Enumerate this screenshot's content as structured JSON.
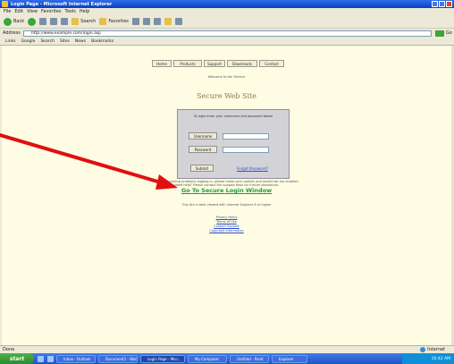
{
  "window": {
    "title": "Login Page - Microsoft Internet Explorer"
  },
  "menubar": [
    "File",
    "Edit",
    "View",
    "Favorites",
    "Tools",
    "Help"
  ],
  "toolbar": {
    "back_label": "Back",
    "search_label": "Search",
    "favorites_label": "Favorites"
  },
  "addressbar": {
    "label": "Address",
    "url": "http://www.example.com/login.asp",
    "go_label": "Go",
    "links_label": "Links"
  },
  "linksbar": [
    "Google",
    "Search",
    "Sites",
    "News",
    "Bookmarks"
  ],
  "page": {
    "nav": [
      "Home",
      "Products",
      "Support",
      "Downloads",
      "Contact"
    ],
    "welcome_line": "Welcome to the Service",
    "heading": "Secure Web Site",
    "login": {
      "prompt": "To login enter your username and password below",
      "username_label": "Username",
      "password_label": "Password",
      "submit_label": "Submit",
      "forgot_label": "Forgot Password?"
    },
    "notice_line_1": "If you are having problems logging in, please make sure cookies and JavaScript are enabled.",
    "notice_line_2": "Need help? Please contact the support desk for further assistance.",
    "green_link": "Go To Secure Login Window",
    "info_line": "This site is best viewed with Internet Explorer 6 or higher",
    "footer_links": [
      "Privacy Policy",
      "Terms of Use",
      "Contact Support",
      "Copyright Information"
    ]
  },
  "statusbar": {
    "left": "Done",
    "zone": "Internet"
  },
  "taskbar": {
    "start_label": "start",
    "tasks": [
      "Inbox - Outlook",
      "Document1 - Word",
      "Login Page - Micr...",
      "My Computer",
      "Untitled - Paint",
      "Explorer"
    ],
    "clock": "10:42 AM"
  },
  "colors": {
    "page_bg": "#fefde3",
    "green_link": "#1f9a3a",
    "annotation_arrow": "#e01010",
    "xp_blue": "#1e53c7"
  }
}
